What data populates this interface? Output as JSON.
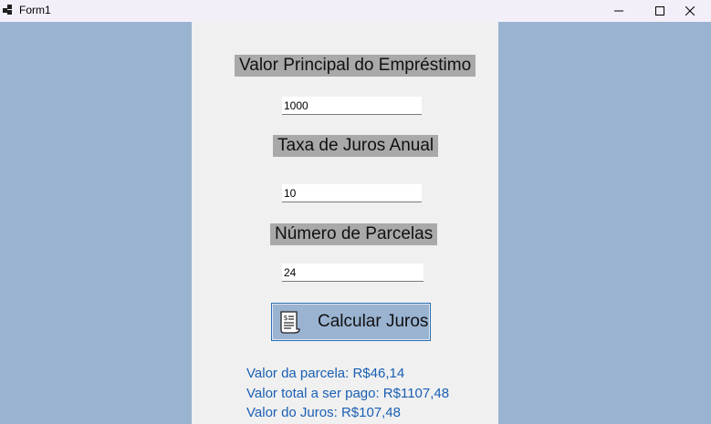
{
  "window": {
    "title": "Form1"
  },
  "form": {
    "principal_label": "Valor Principal do Empréstimo",
    "principal_value": "1000",
    "rate_label": "Taxa de Juros Anual",
    "rate_value": "10",
    "installments_label": "Número de Parcelas",
    "installments_value": "24",
    "calculate_label": "Calcular Juros",
    "calculate_icon": "receipt-icon"
  },
  "results": {
    "installment": "Valor da parcela: R$46,14",
    "total": "Valor total a ser pago: R$1107,48",
    "interest": "Valor do Juros: R$107,48"
  },
  "colors": {
    "background": "#9ab3d1",
    "panel": "#f0f0f0",
    "label_bg": "#a9a9a9",
    "result_text": "#1a5fb4",
    "button_border": "#2a6fb0"
  }
}
